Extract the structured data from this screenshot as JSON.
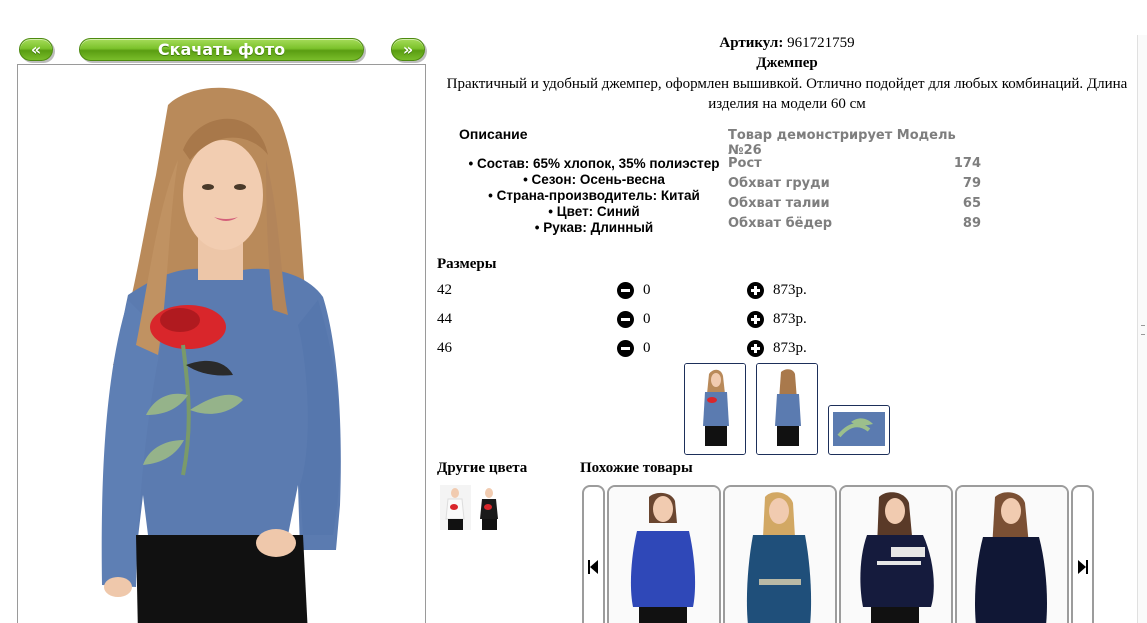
{
  "nav": {
    "prev_label": "«",
    "download_label": "Скачать фото",
    "next_label": "»"
  },
  "product": {
    "sku_label": "Артикул:",
    "sku_value": "961721759",
    "name": "Джемпер",
    "description": "Практичный и удобный джемпер, оформлен вышивкой. Отлично подойдет для любых комбинаций. Длина изделия на модели 60 см"
  },
  "description_block": {
    "title": "Описание",
    "items": [
      "Состав: 65% хлопок, 35% полиэстер",
      "Сезон: Осень-весна",
      "Страна-производитель: Китай",
      "Цвет: Синий",
      "Рукав: Длинный"
    ]
  },
  "model": {
    "header": "Товар демонстрирует Модель №26",
    "rows": [
      {
        "label": "Рост",
        "value": "174"
      },
      {
        "label": "Обхват груди",
        "value": "79"
      },
      {
        "label": "Обхват талии",
        "value": "65"
      },
      {
        "label": "Обхват бёдер",
        "value": "89"
      }
    ]
  },
  "sizes": {
    "title": "Размеры",
    "rows": [
      {
        "size": "42",
        "qty": "0",
        "price": "873р."
      },
      {
        "size": "44",
        "qty": "0",
        "price": "873р."
      },
      {
        "size": "46",
        "qty": "0",
        "price": "873р."
      }
    ]
  },
  "other_colors": {
    "title": "Другие цвета"
  },
  "similar": {
    "title": "Похожие товары"
  },
  "colors": {
    "button_green": "#7cc22c",
    "sweater_blue": "#5b7bb0",
    "thumb_border": "#1d2f5a"
  }
}
